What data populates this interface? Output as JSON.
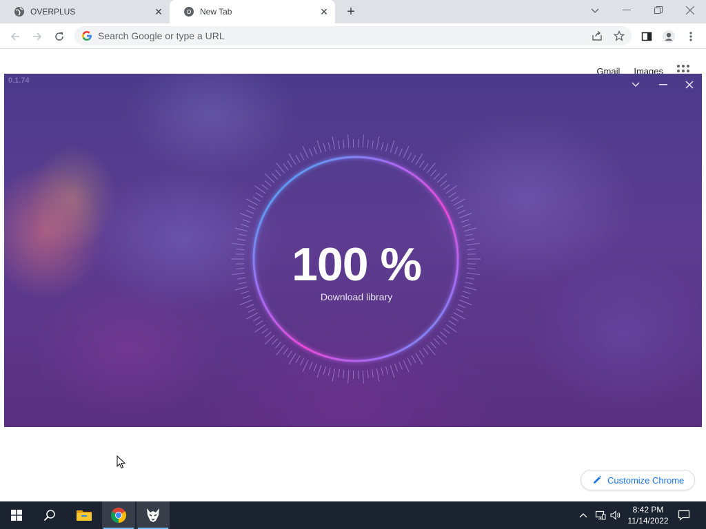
{
  "browser": {
    "tabs": [
      {
        "title": "OVERPLUS",
        "active": false
      },
      {
        "title": "New Tab",
        "active": true
      }
    ],
    "omnibox_placeholder": "Search Google or type a URL"
  },
  "ntp": {
    "gmail_label": "Gmail",
    "images_label": "Images",
    "customize_label": "Customize Chrome"
  },
  "overlay": {
    "version": "0.1.74",
    "progress_text": "100 %",
    "progress_value": 100,
    "status_text": "Download library",
    "colors": {
      "ring_start": "#31b8f0",
      "ring_mid": "#a36bf2",
      "ring_end": "#e64ad8"
    }
  },
  "taskbar": {
    "time": "8:42 PM",
    "date": "11/14/2022",
    "items": [
      "start-icon",
      "search-icon",
      "file-explorer-icon",
      "chrome-icon",
      "overplus-wolf-icon"
    ]
  }
}
